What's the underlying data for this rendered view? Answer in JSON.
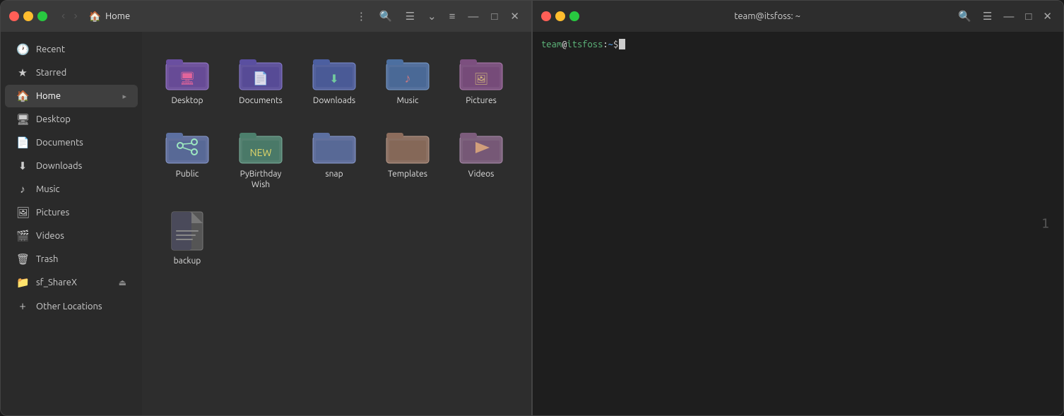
{
  "filemanager": {
    "title": "Home",
    "nav": {
      "back_label": "‹",
      "forward_label": "›"
    },
    "toolbar": {
      "menu_label": "⋮",
      "search_label": "🔍",
      "view_list_label": "☰",
      "view_dropdown_label": "⌄",
      "view_other_label": "≡",
      "minimize_label": "—",
      "maximize_label": "□",
      "close_label": "✕"
    },
    "sidebar": {
      "items": [
        {
          "id": "recent",
          "label": "Recent",
          "icon": "🕐"
        },
        {
          "id": "starred",
          "label": "Starred",
          "icon": "★"
        },
        {
          "id": "home",
          "label": "Home",
          "icon": "🏠",
          "active": true
        },
        {
          "id": "desktop",
          "label": "Desktop",
          "icon": "🖥"
        },
        {
          "id": "documents",
          "label": "Documents",
          "icon": "📄"
        },
        {
          "id": "downloads",
          "label": "Downloads",
          "icon": "⬇"
        },
        {
          "id": "music",
          "label": "Music",
          "icon": "♪"
        },
        {
          "id": "pictures",
          "label": "Pictures",
          "icon": "🖼"
        },
        {
          "id": "videos",
          "label": "Videos",
          "icon": "🎬"
        },
        {
          "id": "trash",
          "label": "Trash",
          "icon": "🗑"
        },
        {
          "id": "sf_sharex",
          "label": "sf_ShareX",
          "icon": "📁",
          "has_eject": true
        },
        {
          "id": "other_locations",
          "label": "Other Locations",
          "icon": "+"
        }
      ]
    },
    "files": [
      {
        "id": "desktop",
        "label": "Desktop",
        "type": "folder",
        "color": "desktop"
      },
      {
        "id": "documents",
        "label": "Documents",
        "type": "folder",
        "color": "documents"
      },
      {
        "id": "downloads",
        "label": "Downloads",
        "type": "folder",
        "color": "downloads"
      },
      {
        "id": "music",
        "label": "Music",
        "type": "folder",
        "color": "music"
      },
      {
        "id": "pictures",
        "label": "Pictures",
        "type": "folder",
        "color": "pictures"
      },
      {
        "id": "public",
        "label": "Public",
        "type": "folder",
        "color": "public"
      },
      {
        "id": "pybirthday",
        "label": "PyBirthday Wish",
        "type": "folder",
        "color": "pybirthday"
      },
      {
        "id": "snap",
        "label": "snap",
        "type": "folder",
        "color": "snap"
      },
      {
        "id": "templates",
        "label": "Templates",
        "type": "folder",
        "color": "templates"
      },
      {
        "id": "videos",
        "label": "Videos",
        "type": "folder",
        "color": "videos"
      },
      {
        "id": "backup",
        "label": "backup",
        "type": "file"
      }
    ]
  },
  "terminal": {
    "title": "team@itsfoss: ~",
    "toolbar": {
      "search_label": "🔍",
      "menu_label": "☰",
      "minimize_label": "—",
      "maximize_label": "□",
      "close_label": "✕"
    },
    "prompt": {
      "user": "team",
      "at": "@",
      "host": "itsfoss",
      "colon": ":",
      "tilde": "~",
      "dollar": "$"
    },
    "line_number": "1"
  }
}
